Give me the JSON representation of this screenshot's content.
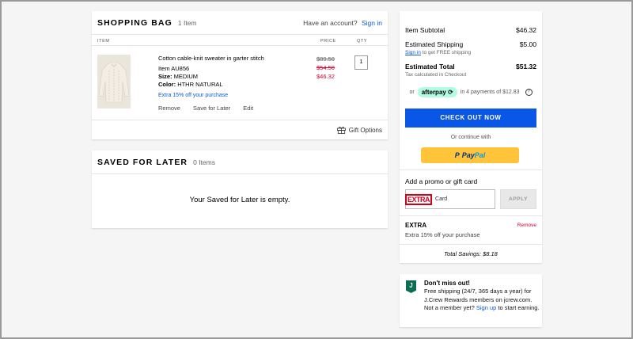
{
  "bag": {
    "title": "SHOPPING BAG",
    "count": "1 Item",
    "account_prompt": "Have an account?",
    "sign_in": "Sign in",
    "col_item": "ITEM",
    "col_price": "PRICE",
    "col_qty": "QTY",
    "item": {
      "name": "Cotton cable-knit sweater in garter stitch",
      "number": "Item AU856",
      "size_label": "Size:",
      "size": "MEDIUM",
      "color_label": "Color:",
      "color": "HTHR NATURAL",
      "promo": "Extra 15% off your purchase",
      "price_original": "$89.50",
      "price_sale": "$54.50",
      "price_final": "$46.32",
      "qty": "1",
      "actions": [
        "Remove",
        "Save for Later",
        "Edit"
      ]
    },
    "gift_options": "Gift Options"
  },
  "saved": {
    "title": "SAVED FOR LATER",
    "count": "0 Items",
    "empty_message": "Your Saved for Later is empty."
  },
  "summary": {
    "subtotal_label": "Item Subtotal",
    "subtotal": "$46.32",
    "shipping_label": "Estimated Shipping",
    "shipping": "$5.00",
    "shipping_signin": "Sign in",
    "shipping_note": " to get FREE shipping",
    "total_label": "Estimated Total",
    "total": "$51.32",
    "tax_note": "Tax calculated in Checkout",
    "afterpay_or": "or",
    "afterpay_logo": "afterpay",
    "afterpay_text": "in 4 payments of $12.83",
    "checkout": "CHECK OUT NOW",
    "or_continue": "Or continue with",
    "paypal_1": "Pay",
    "paypal_2": "Pal",
    "promo_title": "Add a promo or gift card",
    "promo_logo": "EXTRA",
    "promo_placeholder": "Card",
    "apply": "APPLY",
    "applied_name": "EXTRA",
    "applied_desc": "Extra 15% off your purchase",
    "remove": "Remove",
    "total_savings": "Total Savings: $8.18"
  },
  "rewards": {
    "badge": "J",
    "title": "Don't miss out!",
    "text": "Free shipping (24/7, 365 days a year) for J.Crew Rewards members on jcrew.com. Not a member yet?",
    "signup": "Sign up",
    "text_end": "to start earning."
  },
  "colors": {
    "accent": "#0a56e6",
    "link": "#0a5bd3",
    "sale_red": "#c03",
    "paypal": "#ffc439",
    "afterpay": "#b2fce4"
  }
}
